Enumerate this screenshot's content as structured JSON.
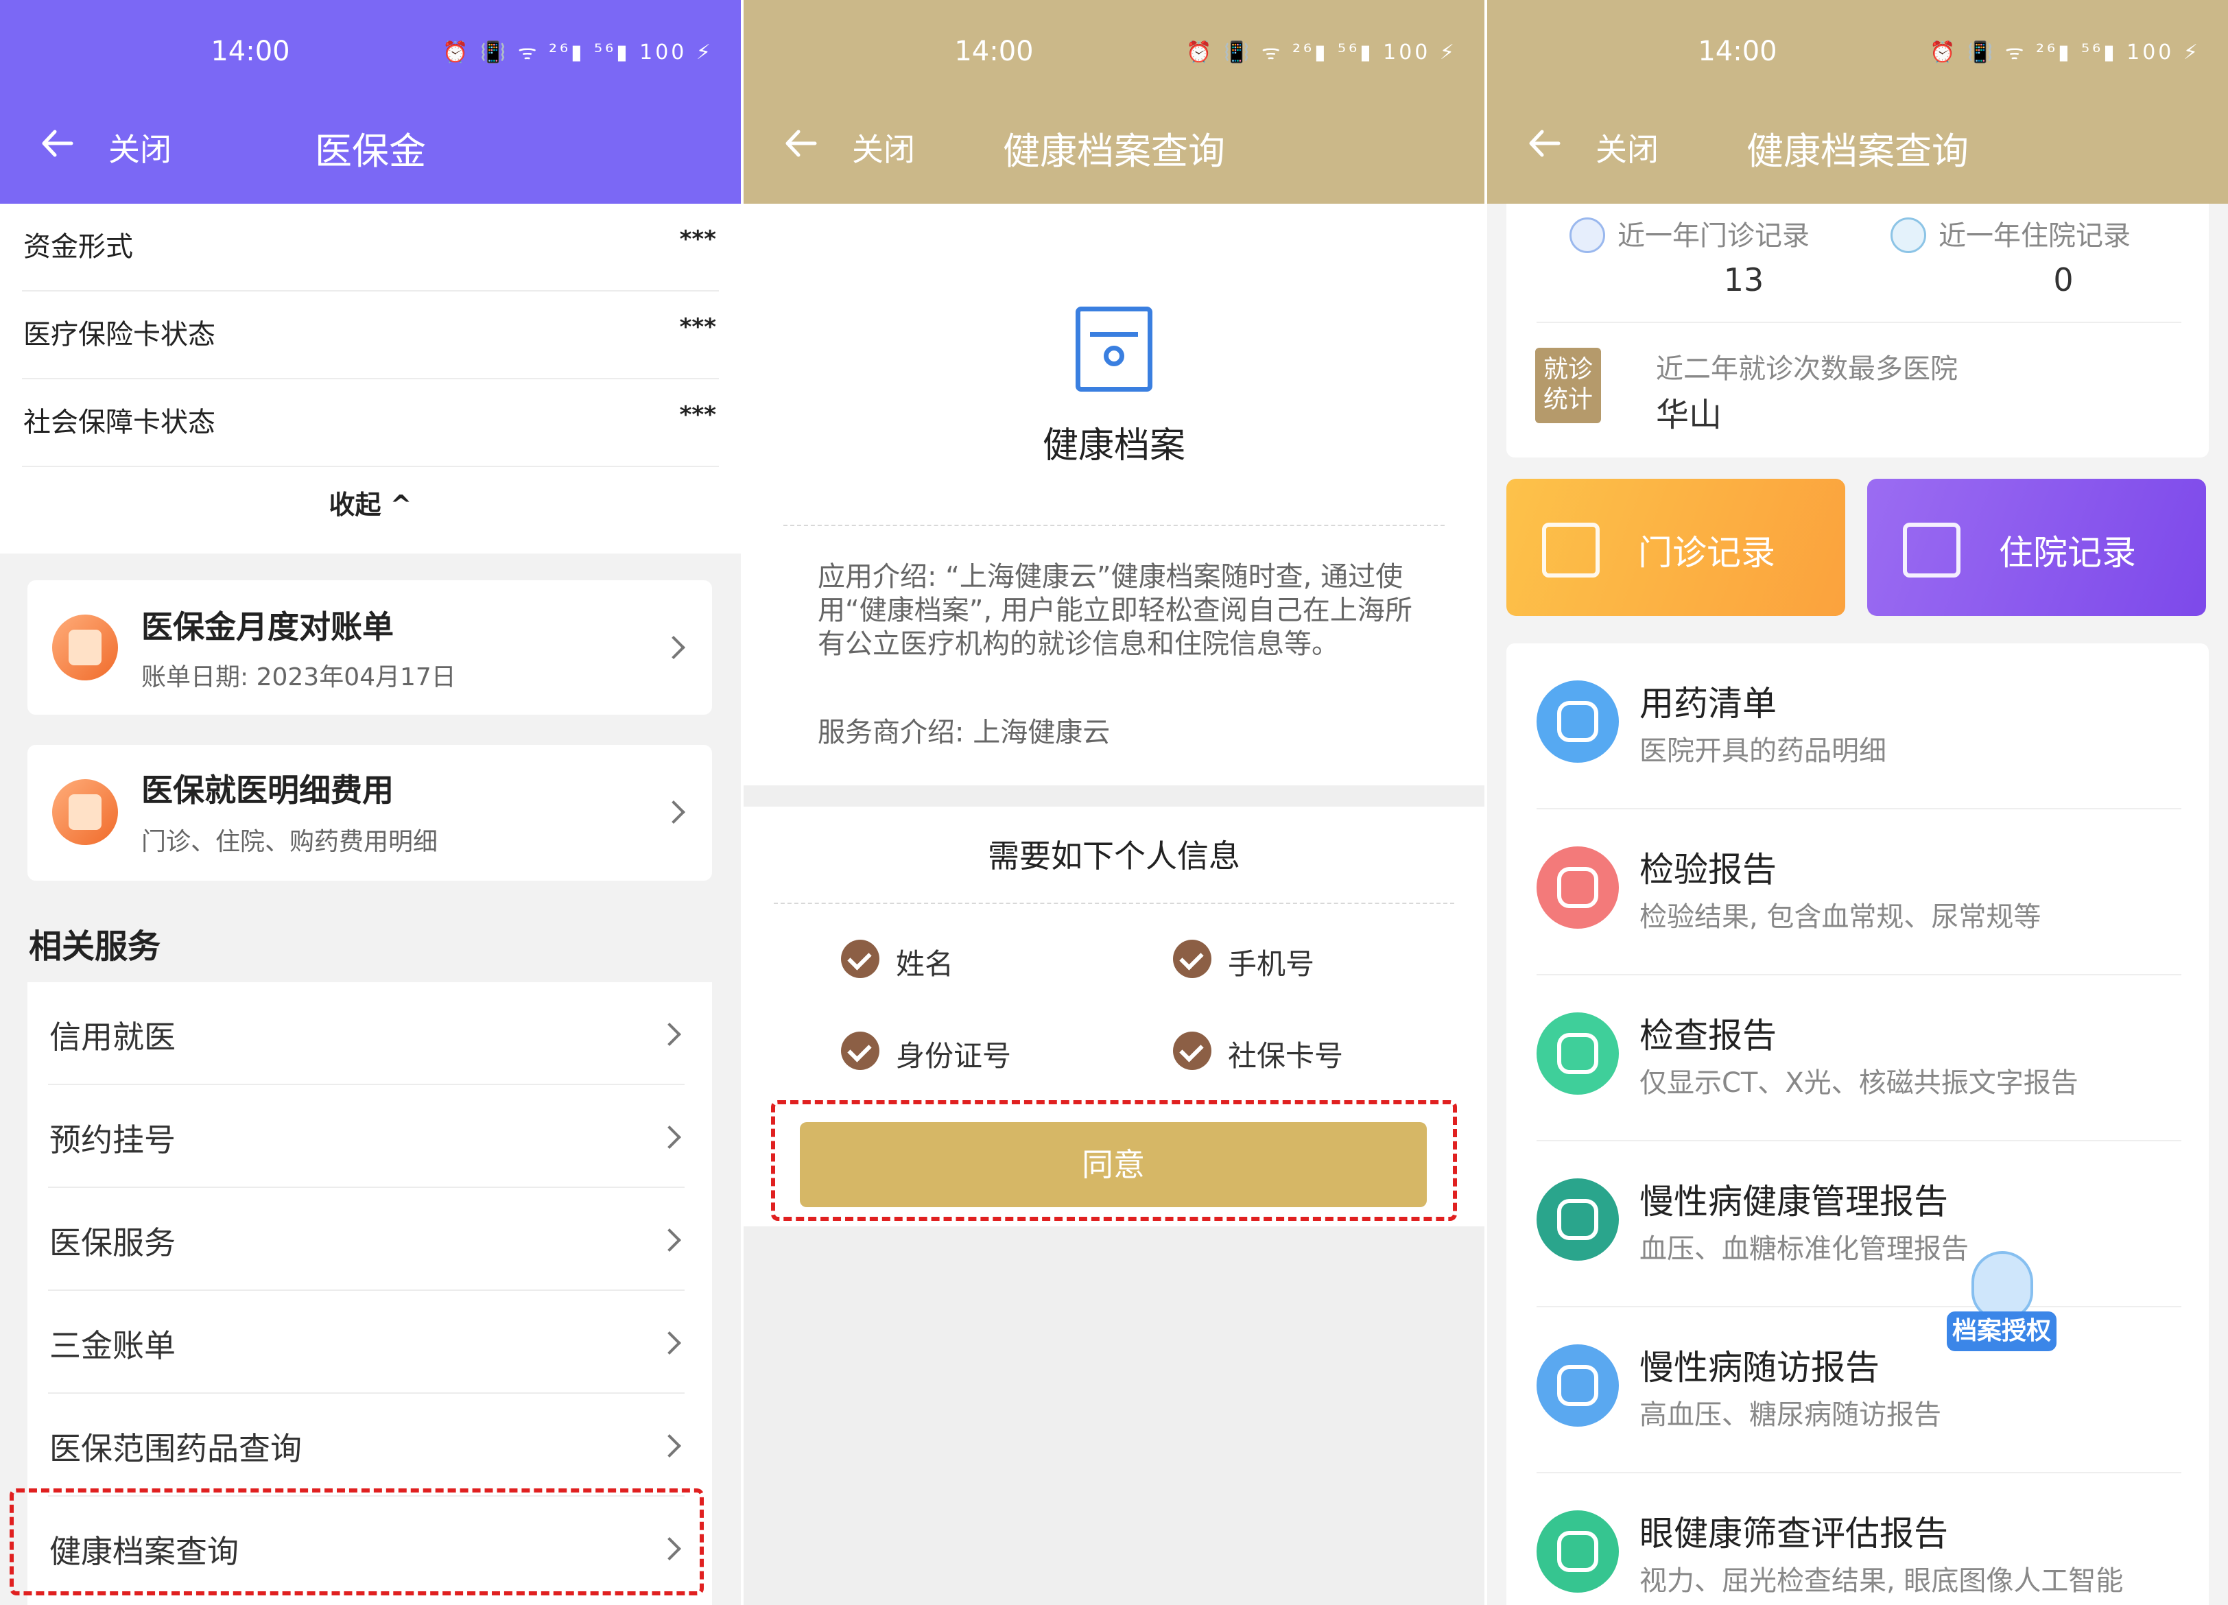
{
  "status_bar": {
    "time": "14:00",
    "icons": "⏰ 📳 ᯤ ²⁶▮ ⁵⁶▮ 100 ⚡"
  },
  "colors": {
    "panel1_header": "#7b68f5",
    "panel23_header": "#cbb889",
    "agree_button": "#d6b766",
    "highlight_dashes": "#e02020",
    "check": "#8c5f45"
  },
  "panel1": {
    "close_label": "关闭",
    "title": "医保金",
    "fields": [
      {
        "label": "资金形式",
        "value": "***"
      },
      {
        "label": "医疗保险卡状态",
        "value": "***"
      },
      {
        "label": "社会保障卡状态",
        "value": "***"
      }
    ],
    "collapse_label": "收起 ^",
    "cards": [
      {
        "title": "医保金月度对账单",
        "subtitle": "账单日期:   2023年04月17日",
        "icon": "bill-icon"
      },
      {
        "title": "医保就医明细费用",
        "subtitle": "门诊、住院、购药费用明细",
        "icon": "receipt-icon"
      }
    ],
    "related_heading": "相关服务",
    "services": [
      "信用就医",
      "预约挂号",
      "医保服务",
      "三金账单",
      "医保范围药品查询",
      "健康档案查询"
    ]
  },
  "panel2": {
    "close_label": "关闭",
    "title": "健康档案查询",
    "doc_title": "健康档案",
    "intro": "应用介绍:   “上海健康云”健康档案随时查, 通过使用“健康档案”, 用户能立即轻松查阅自己在上海所有公立医疗机构的就诊信息和住院信息等。",
    "provider": "服务商介绍:   上海健康云",
    "info_title": "需要如下个人信息",
    "required_info": [
      "姓名",
      "手机号",
      "身份证号",
      "社保卡号"
    ],
    "agree_label": "同意"
  },
  "panel3": {
    "close_label": "关闭",
    "title": "健康档案查询",
    "outpatient_label": "近一年门诊记录",
    "outpatient_count": "13",
    "inpatient_label": "近一年住院记录",
    "inpatient_count": "0",
    "visit_badge": "就诊统计",
    "most_visited_label": "近二年就诊次数最多医院",
    "most_visited_value": "华山",
    "outpatient_button": "门诊记录",
    "inpatient_button": "住院记录",
    "reports": [
      {
        "title": "用药清单",
        "subtitle": "医院开具的药品明细",
        "icon": "pill-icon",
        "color": "#56a9f2"
      },
      {
        "title": "检验报告",
        "subtitle": "检验结果, 包含血常规、尿常规等",
        "icon": "blood-drop-icon",
        "color": "#f37a7a"
      },
      {
        "title": "检查报告",
        "subtitle": "仅显示CT、X光、核磁共振文字报告",
        "icon": "scan-icon",
        "color": "#3fcf9a"
      },
      {
        "title": "慢性病健康管理报告",
        "subtitle": "血压、血糖标准化管理报告",
        "icon": "chronic-care-icon",
        "color": "#2aa58c"
      },
      {
        "title": "慢性病随访报告",
        "subtitle": "高血压、糖尿病随访报告",
        "icon": "heart-follow-up-icon",
        "color": "#5aa8f0"
      },
      {
        "title": "眼健康筛查评估报告",
        "subtitle": "视力、屈光检查结果, 眼底图像人工智能",
        "icon": "eye-icon",
        "color": "#36c590"
      }
    ],
    "auth_label": "档案授权"
  }
}
